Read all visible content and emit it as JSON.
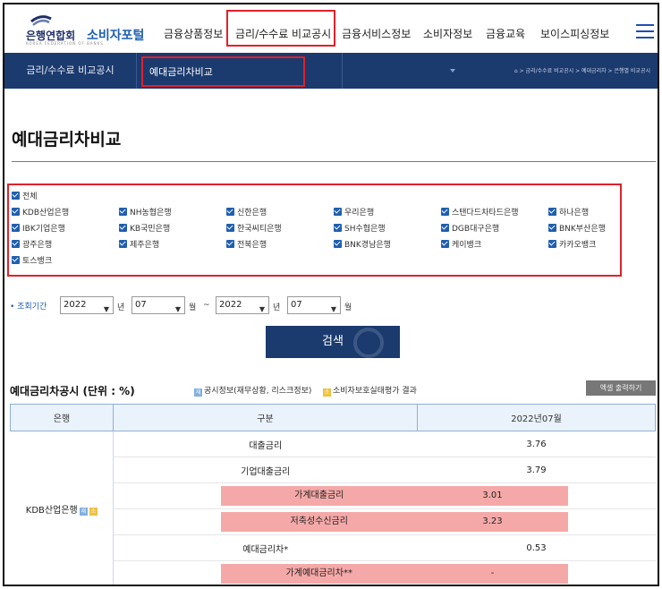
{
  "header": {
    "logo_name": "은행연합회",
    "logo_portal": "소비자포털",
    "logo_sub": "KOREA FEDERATION OF BANKS",
    "nav": [
      "금융상품정보",
      "금리/수수료 비교공시",
      "금융서비스정보",
      "소비자정보",
      "금융교육",
      "보이스피싱정보"
    ]
  },
  "subbar": {
    "section": "금리/수수료 비교공시",
    "current": "예대금리차비교",
    "breadcrumb": "⌂ > 금리/수수료 비교공시 > 예대금리차 > 은행별 비교공시"
  },
  "page_title": "예대금리차비교",
  "banks": {
    "all_label": "전체",
    "items": [
      "KDB산업은행",
      "NH농협은행",
      "신한은행",
      "우리은행",
      "스탠다드차타드은행",
      "하나은행",
      "IBK기업은행",
      "KB국민은행",
      "한국씨티은행",
      "SH수협은행",
      "DGB대구은행",
      "BNK부산은행",
      "광주은행",
      "제주은행",
      "전북은행",
      "BNK경남은행",
      "케이뱅크",
      "카카오뱅크",
      "토스뱅크"
    ]
  },
  "period": {
    "label": "조회기간",
    "from_year": "2022",
    "from_month": "07",
    "to_year": "2022",
    "to_month": "07",
    "year_unit": "년",
    "month_unit": "월",
    "tilde": "~"
  },
  "search_label": "검색",
  "section": {
    "title": "예대금리차공시 (단위 : %)",
    "legend1": "공시정보(재무상황, 리스크정보)",
    "legend2": "소비자보호실태평가 결과",
    "legend1_badge": "재",
    "legend2_badge": "소",
    "excel": "엑셀 출력하기"
  },
  "table": {
    "headers": [
      "은행",
      "구분",
      "2022년07월"
    ],
    "bank": "KDB산업은행",
    "rows": [
      {
        "label": "대출금리",
        "value": "3.76",
        "hl": false
      },
      {
        "label": "기업대출금리",
        "value": "3.79",
        "hl": false
      },
      {
        "label": "가계대출금리",
        "value": "3.01",
        "hl": true
      },
      {
        "label": "저축성수신금리",
        "value": "3.23",
        "hl": true
      },
      {
        "label": "예대금리차*",
        "value": "0.53",
        "hl": false
      },
      {
        "label": "가계예대금리차**",
        "value": "-",
        "hl": true
      }
    ]
  },
  "colors": {
    "navy": "#1b3a6e",
    "highlight": "#f4a9a8",
    "annotation": "#e0212a",
    "checkbox": "#1f5fb0"
  }
}
